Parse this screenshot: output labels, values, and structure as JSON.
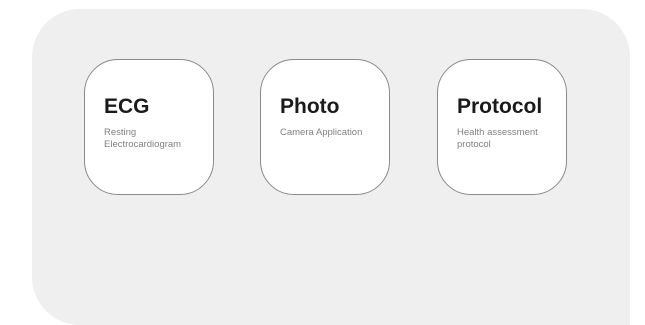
{
  "cards": [
    {
      "title": "ECG",
      "description": "Resting Electrocardiogram"
    },
    {
      "title": "Photo",
      "description": "Camera Application"
    },
    {
      "title": "Protocol",
      "description": "Health assessment protocol"
    }
  ]
}
